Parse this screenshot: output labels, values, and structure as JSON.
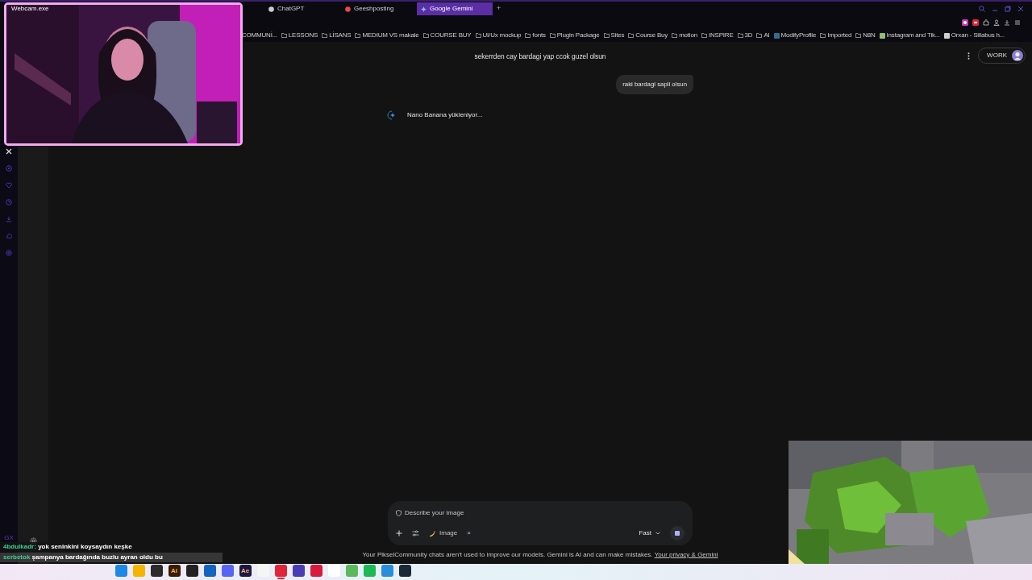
{
  "webcam": {
    "title": "Webcam.exe",
    "kind": "picture"
  },
  "tabs": [
    {
      "label": "ChatGPT",
      "selected": false
    },
    {
      "label": "Geeshposting",
      "selected": false
    },
    {
      "label": "Google Gemini",
      "selected": true
    }
  ],
  "new_tab": "+",
  "bookmarks": [
    {
      "label": "COMMUNİ...",
      "kind": "text"
    },
    {
      "label": "LESSONS",
      "kind": "folder"
    },
    {
      "label": "LİSANS",
      "kind": "folder"
    },
    {
      "label": "MEDIUM VS makale",
      "kind": "folder"
    },
    {
      "label": "COURSE BUY",
      "kind": "folder"
    },
    {
      "label": "UI/Ux mockup",
      "kind": "folder"
    },
    {
      "label": "fonts",
      "kind": "folder"
    },
    {
      "label": "Plugin Package",
      "kind": "folder"
    },
    {
      "label": "Sites",
      "kind": "folder"
    },
    {
      "label": "Course Buy",
      "kind": "folder"
    },
    {
      "label": "motion",
      "kind": "folder"
    },
    {
      "label": "INSPIRE",
      "kind": "folder"
    },
    {
      "label": "3D",
      "kind": "folder"
    },
    {
      "label": "AI",
      "kind": "folder"
    },
    {
      "label": "ModifyProfile",
      "kind": "site",
      "color": "#2f6f8f"
    },
    {
      "label": "Imported",
      "kind": "folder"
    },
    {
      "label": "N8N",
      "kind": "folder"
    },
    {
      "label": "Instagram and Tik...",
      "kind": "site",
      "color": "#8fbf6f"
    },
    {
      "label": "Orxan - Sillabus h...",
      "kind": "site",
      "color": "#cfcfcf"
    }
  ],
  "sidebar": {
    "brand": "GX"
  },
  "header": {
    "title": "sekerrden cay bardagi yap ccok guzel olsun",
    "account": "WORK"
  },
  "messages": [
    {
      "kind": "user",
      "text": "raki bardagi sapli olsun"
    },
    {
      "kind": "status",
      "text": "Nano Banana yükleniyor..."
    }
  ],
  "composer": {
    "placeholder": "Describe your image",
    "chip": "Image",
    "chip_close": "×",
    "mode": "Fast"
  },
  "footer": {
    "text": "Your PikselCommunity chats aren't used to improve our models. Gemini is AI and can make mistakes.",
    "link": "Your privacy & Gemini"
  },
  "chat": [
    {
      "user": "4bdulkadr:",
      "text": "yok seninkini koysaydın keşke",
      "color": "#3ecf8e"
    },
    {
      "user": "serbetok",
      "text": "şampanya bardağında buzlu ayran oldu bu",
      "color": "#3ecf8e"
    }
  ],
  "taskbar": [
    {
      "color": "#1e88e5",
      "selected": false
    },
    {
      "color": "#f4b400",
      "selected": false
    },
    {
      "color": "#2b2b2b",
      "selected": false
    },
    {
      "color": "#3a1c00",
      "label": "Ai",
      "selected": false
    },
    {
      "color": "#222222",
      "selected": false
    },
    {
      "color": "#1565c0",
      "selected": false
    },
    {
      "color": "#5865f2",
      "selected": false
    },
    {
      "color": "#1a1845",
      "label": "Ae",
      "selected": false
    },
    {
      "color": "#f5f5f5",
      "selected": false
    },
    {
      "color": "#e0253b",
      "selected": true
    },
    {
      "color": "#4b3bb5",
      "selected": false
    },
    {
      "color": "#d81b3c",
      "selected": false
    },
    {
      "color": "#ffffff",
      "selected": false
    },
    {
      "color": "#5cb85c",
      "selected": false
    },
    {
      "color": "#1db954",
      "selected": false
    },
    {
      "color": "#2a8fd8",
      "selected": false
    },
    {
      "color": "#1b2838",
      "selected": false
    }
  ]
}
